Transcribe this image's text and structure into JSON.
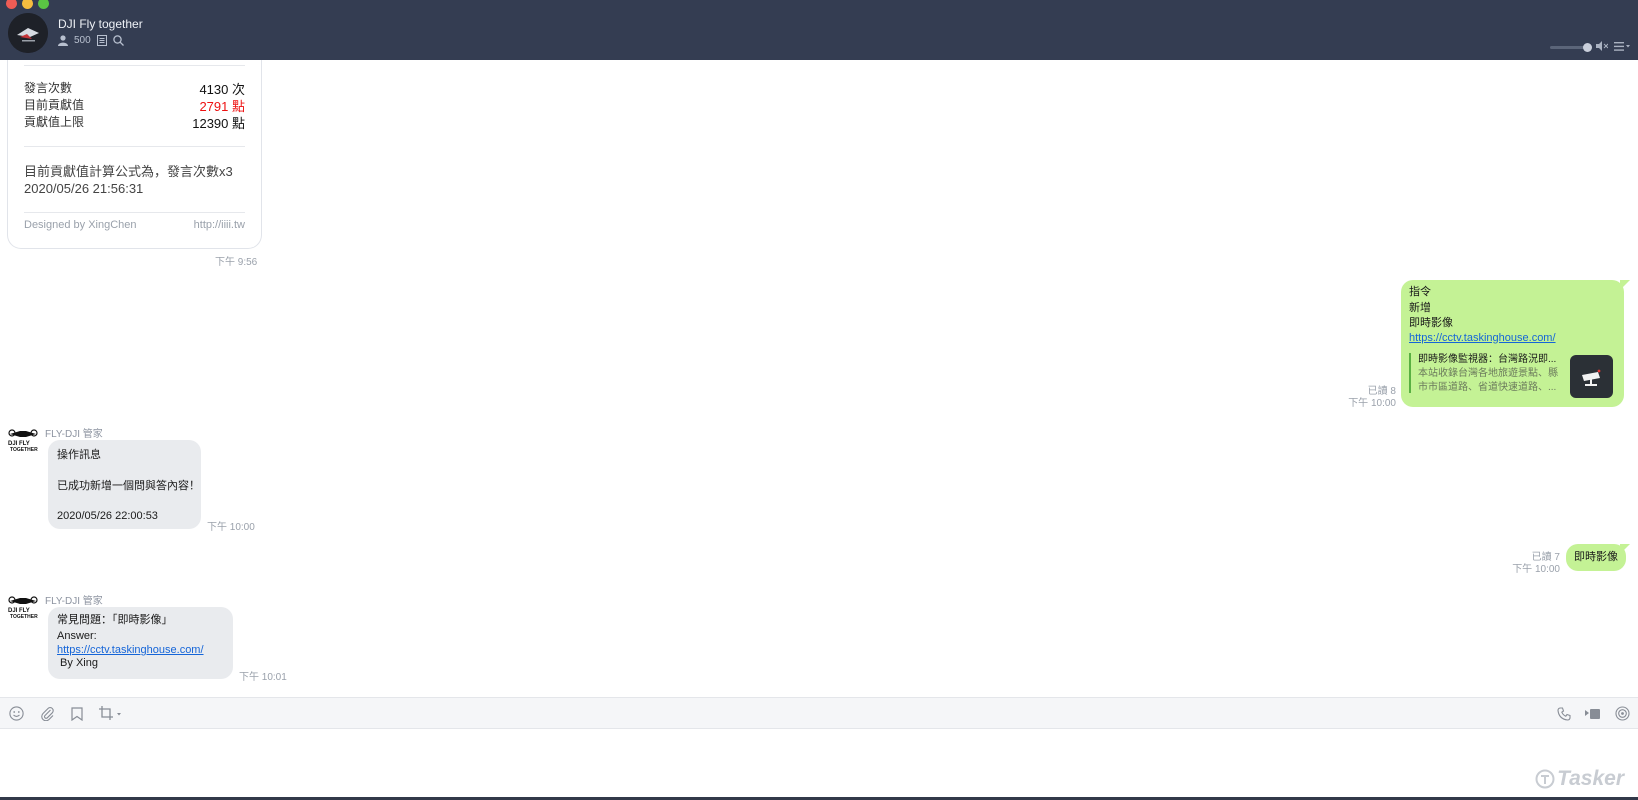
{
  "header": {
    "title": "DJI Fly together",
    "member_count": "500"
  },
  "stats_card": {
    "rows": [
      {
        "label": "發言次數",
        "value": "4130 次"
      },
      {
        "label": "目前貢獻值",
        "value": "2791 點"
      },
      {
        "label": "貢獻值上限",
        "value": "12390 點"
      }
    ],
    "formula_line1": "目前貢獻值計算公式為，發言次數x3",
    "formula_line2": "2020/05/26 21:56:31",
    "footer_left": "Designed by XingChen",
    "footer_right": "http://iiii.tw",
    "time": "下午 9:56"
  },
  "messages": {
    "command": {
      "lines": [
        "指令",
        "新增",
        "即時影像"
      ],
      "link": "https://cctv.taskinghouse.com/",
      "preview_title": "即時影像監視器：台灣路況即...",
      "preview_desc1": "本站收錄台灣各地旅遊景點、縣",
      "preview_desc2": "市市區道路、省道快速道路、...",
      "read": "已讀 8",
      "time": "下午 10:00"
    },
    "bot_reply_1": {
      "sender": "FLY-DJI 管家",
      "line1": "操作訊息",
      "line2": "已成功新增一個問與答內容！",
      "line3": "2020/05/26 22:00:53",
      "time": "下午 10:00"
    },
    "short_sent": {
      "text": "即時影像",
      "read": "已讀 7",
      "time": "下午 10:00"
    },
    "bot_reply_2": {
      "sender": "FLY-DJI 管家",
      "line1": "常見問題：「即時影像」",
      "line2": "Answer:",
      "link": "https://cctv.taskinghouse.com/",
      "line4": " By Xing",
      "time": "下午 10:01"
    }
  },
  "watermark": "Tasker",
  "icons": [
    "user-icon",
    "note-icon",
    "search-icon",
    "volume-slider",
    "mute-icon",
    "menu-icon",
    "emoji-icon",
    "attach-icon",
    "bookmark-icon",
    "crop-icon",
    "phone-icon",
    "video-icon",
    "live-icon"
  ]
}
